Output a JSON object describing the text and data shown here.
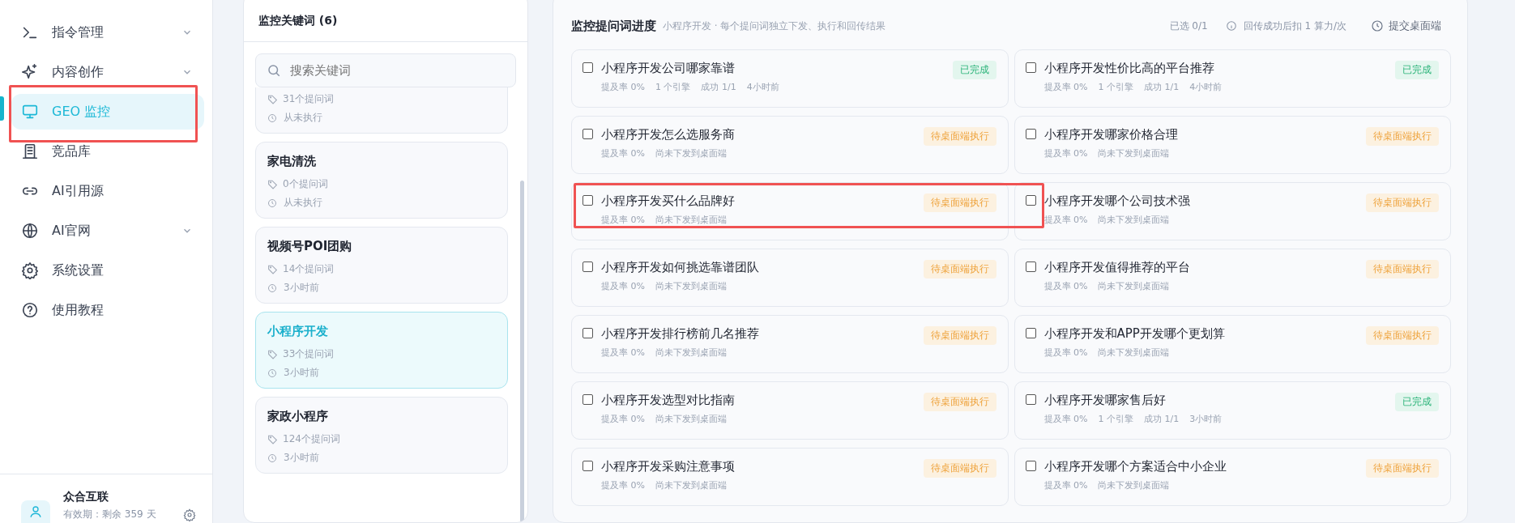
{
  "sidebar": {
    "nav": [
      {
        "label": "指令管理",
        "expandable": true,
        "selected": false
      },
      {
        "label": "内容创作",
        "expandable": true,
        "selected": false
      },
      {
        "label": "GEO 监控",
        "expandable": false,
        "selected": true
      },
      {
        "label": "竞品库",
        "expandable": false,
        "selected": false
      },
      {
        "label": "AI引用源",
        "expandable": false,
        "selected": false
      },
      {
        "label": "AI官网",
        "expandable": true,
        "selected": false
      },
      {
        "label": "系统设置",
        "expandable": false,
        "selected": false
      },
      {
        "label": "使用教程",
        "expandable": false,
        "selected": false
      }
    ],
    "user": {
      "name": "众合互联",
      "expiry": "有效期：剩余 359 天"
    }
  },
  "keywords": {
    "title": "监控关键词 (6)",
    "search": {
      "placeholder": "搜索关键词"
    },
    "items": [
      {
        "count": "31个提问词",
        "last_run": "从未执行",
        "selected": false
      },
      {
        "name": "家电清洗",
        "count": "0个提问词",
        "last_run": "从未执行",
        "selected": false
      },
      {
        "name": "视频号POI团购",
        "count": "14个提问词",
        "last_run": "3小时前",
        "selected": false
      },
      {
        "name": "小程序开发",
        "count": "33个提问词",
        "last_run": "3小时前",
        "selected": true
      },
      {
        "name": "家政小程序",
        "count": "124个提问词",
        "last_run": "3小时前",
        "selected": false
      }
    ]
  },
  "progress": {
    "title": "监控提问词进度",
    "subtitle": "小程序开发 · 每个提问词独立下发、执行和回传结果",
    "selected_count": "已选 0/1",
    "cost_note": "回传成功后扣 1 算力/次",
    "submit_label": "提交桌面端",
    "prompts": [
      {
        "text": "小程序开发公司哪家靠谱",
        "checked": false,
        "kind": "done",
        "status": "已完成",
        "meta": [
          "提及率 0%",
          "1 个引擎",
          "成功 1/1",
          "4小时前"
        ]
      },
      {
        "text": "小程序开发性价比高的平台推荐",
        "checked": false,
        "kind": "done",
        "status": "已完成",
        "meta": [
          "提及率 0%",
          "1 个引擎",
          "成功 1/1",
          "4小时前"
        ]
      },
      {
        "text": "小程序开发怎么选服务商",
        "checked": false,
        "kind": "pending",
        "status": "待桌面端执行",
        "meta": [
          "提及率 0%",
          "尚未下发到桌面端"
        ]
      },
      {
        "text": "小程序开发哪家价格合理",
        "checked": false,
        "kind": "pending",
        "status": "待桌面端执行",
        "meta": [
          "提及率 0%",
          "尚未下发到桌面端"
        ]
      },
      {
        "text": "小程序开发买什么品牌好",
        "checked": false,
        "kind": "pending",
        "status": "待桌面端执行",
        "meta": [
          "提及率 0%",
          "尚未下发到桌面端"
        ]
      },
      {
        "text": "小程序开发哪个公司技术强",
        "checked": false,
        "kind": "pending",
        "status": "待桌面端执行",
        "meta": [
          "提及率 0%",
          "尚未下发到桌面端"
        ]
      },
      {
        "text": "小程序开发如何挑选靠谱团队",
        "checked": false,
        "kind": "pending",
        "status": "待桌面端执行",
        "meta": [
          "提及率 0%",
          "尚未下发到桌面端"
        ]
      },
      {
        "text": "小程序开发值得推荐的平台",
        "checked": false,
        "kind": "pending",
        "status": "待桌面端执行",
        "meta": [
          "提及率 0%",
          "尚未下发到桌面端"
        ]
      },
      {
        "text": "小程序开发排行榜前几名推荐",
        "checked": false,
        "kind": "pending",
        "status": "待桌面端执行",
        "meta": [
          "提及率 0%",
          "尚未下发到桌面端"
        ]
      },
      {
        "text": "小程序开发和APP开发哪个更划算",
        "checked": false,
        "kind": "pending",
        "status": "待桌面端执行",
        "meta": [
          "提及率 0%",
          "尚未下发到桌面端"
        ]
      },
      {
        "text": "小程序开发选型对比指南",
        "checked": false,
        "kind": "pending",
        "status": "待桌面端执行",
        "meta": [
          "提及率 0%",
          "尚未下发到桌面端"
        ]
      },
      {
        "text": "小程序开发哪家售后好",
        "checked": false,
        "kind": "done",
        "status": "已完成",
        "meta": [
          "提及率 0%",
          "1 个引擎",
          "成功 1/1",
          "3小时前"
        ]
      },
      {
        "text": "小程序开发采购注意事项",
        "checked": false,
        "kind": "pending",
        "status": "待桌面端执行",
        "meta": [
          "提及率 0%",
          "尚未下发到桌面端"
        ]
      },
      {
        "text": "小程序开发哪个方案适合中小企业",
        "checked": false,
        "kind": "pending",
        "status": "待桌面端执行",
        "meta": [
          "提及率 0%",
          "尚未下发到桌面端"
        ]
      }
    ]
  }
}
